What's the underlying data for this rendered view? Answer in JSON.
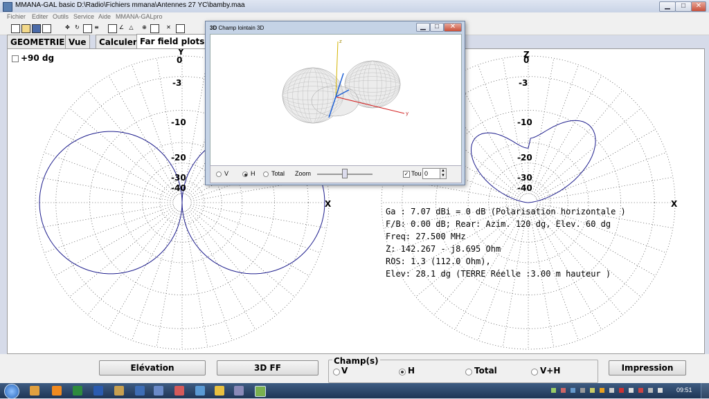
{
  "window": {
    "title": "MMANA-GAL basic D:\\Radio\\Fichiers mmana\\Antennes 27 YC\\bamby.maa",
    "controls": [
      "▁",
      "□",
      "✕"
    ]
  },
  "menu": [
    "Fichier",
    "Editer",
    "Outils",
    "Service",
    "Aide",
    "MMANA-GALpro"
  ],
  "tabs": [
    "GEOMETRIE",
    "Vue",
    "Calculer",
    "Far field plots"
  ],
  "active_tab": "Far field plots",
  "checkbox_plus90": {
    "label": "+90 dg",
    "checked": false
  },
  "left_plot": {
    "top_axis": "Y",
    "right_axis": "X",
    "scale_labels": [
      "0",
      "-3",
      "-10",
      "-20",
      "-30",
      "-40"
    ]
  },
  "right_plot": {
    "top_axis": "Z",
    "right_axis": "X",
    "scale_labels": [
      "0",
      "-3",
      "-10",
      "-20",
      "-30",
      "-40"
    ]
  },
  "results": [
    "Ga : 7.07 dBi = 0 dB  (Polarisation horizontale )",
    "F/B: 0.00 dB; Rear: Azim. 120 dg, Elev. 60 dg",
    "Freq: 27.500 MHz",
    "Z: 142.267 - j8.695 Ohm",
    "ROS: 1.3 (112.0 Ohm),",
    "Elev: 28.1 dg (TERRE Réelle   :3.00 m hauteur )"
  ],
  "bottom": {
    "elevation_button": "Elévation",
    "ff3d_button": "3D FF",
    "champ_title": "Champ(s)",
    "champ_options": [
      "V",
      "H",
      "Total",
      "V+H"
    ],
    "champ_selected": "H",
    "print_button": "Impression"
  },
  "dialog": {
    "title": "Champ lointain 3D",
    "title_prefix": "3D",
    "axis_labels": {
      "z": "z",
      "y": "y"
    },
    "options": [
      "V",
      "H",
      "Total"
    ],
    "selected": "H",
    "zoom_label": "Zoom",
    "tou_label": "Tou",
    "tou_checked": true,
    "tou_value": "0"
  },
  "taskbar": {
    "clock": "09:51"
  },
  "colors": {
    "pattern": "#1c1c8c",
    "grid": "#555555",
    "accent": "#2a4a7a"
  }
}
